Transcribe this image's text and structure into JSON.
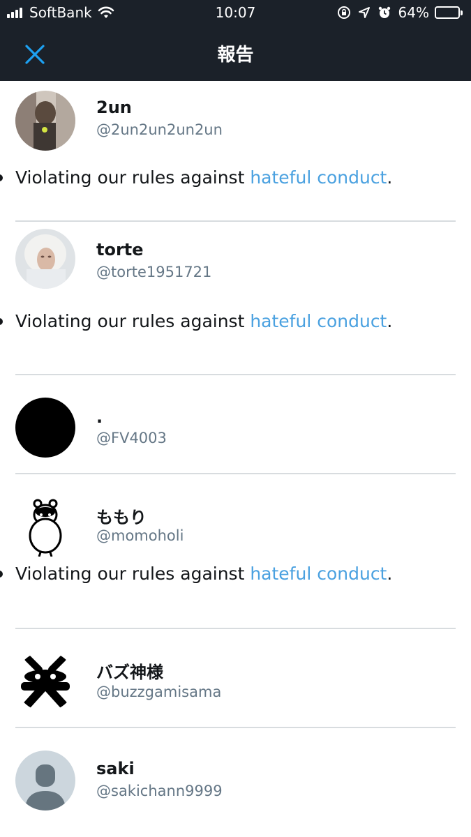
{
  "status_bar": {
    "carrier": "SoftBank",
    "time": "10:07",
    "battery_percent": "64%",
    "battery_level": 0.64,
    "icons": [
      "signal-icon",
      "wifi-icon",
      "rotation-lock-icon",
      "location-icon",
      "alarm-icon",
      "battery-icon"
    ]
  },
  "nav": {
    "title": "報告",
    "close_icon": "close-icon"
  },
  "colors": {
    "header_bg": "#1b2129",
    "accent": "#1da1f2",
    "link": "#4aa1e0",
    "handle": "#657786",
    "divider": "#d8dcdf"
  },
  "reason_text": {
    "prefix": "Violating our rules against ",
    "link": "hateful conduct",
    "suffix": "."
  },
  "accounts": [
    {
      "name": "2un",
      "handle": "@2un2un2un2un",
      "has_reason": true
    },
    {
      "name": "torte",
      "handle": "@torte1951721",
      "has_reason": true
    },
    {
      "name": ".",
      "handle": "@FV4003",
      "has_reason": false
    },
    {
      "name": "ももり",
      "handle": "@momoholi",
      "has_reason": true
    },
    {
      "name": "バズ神様",
      "handle": "@buzzgamisama",
      "has_reason": false
    },
    {
      "name": "saki",
      "handle": "@sakichann9999",
      "has_reason": false
    }
  ]
}
